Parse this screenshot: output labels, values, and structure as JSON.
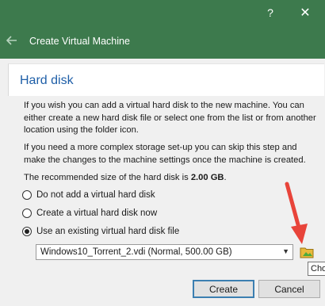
{
  "titlebar": {
    "help_label": "?",
    "close_label": "✕",
    "back_label": "←",
    "wizard_title": "Create Virtual Machine",
    "accent_color": "#3d7a4d"
  },
  "page": {
    "heading": "Hard disk",
    "paragraph1": "If you wish you can add a virtual hard disk to the new machine. You can either create a new hard disk file or select one from the list or from another location using the folder icon.",
    "paragraph2": "If you need a more complex storage set-up you can skip this step and make the changes to the machine settings once the machine is created.",
    "recommended_prefix": "The recommended size of the hard disk is ",
    "recommended_size": "2.00 GB",
    "recommended_suffix": "."
  },
  "options": [
    {
      "label": "Do not add a virtual hard disk",
      "checked": false
    },
    {
      "label": "Create a virtual hard disk now",
      "checked": false
    },
    {
      "label": "Use an existing virtual hard disk file",
      "checked": true
    }
  ],
  "disk_select": {
    "selected": "Windows10_Torrent_2.vdi (Normal, 500.00 GB)",
    "arrow": "▼"
  },
  "folder_button": {
    "icon": "folder-icon",
    "tooltip": "Cho"
  },
  "buttons": {
    "create": "Create",
    "cancel": "Cancel"
  },
  "annotation": {
    "arrow_color": "#e8443a"
  }
}
